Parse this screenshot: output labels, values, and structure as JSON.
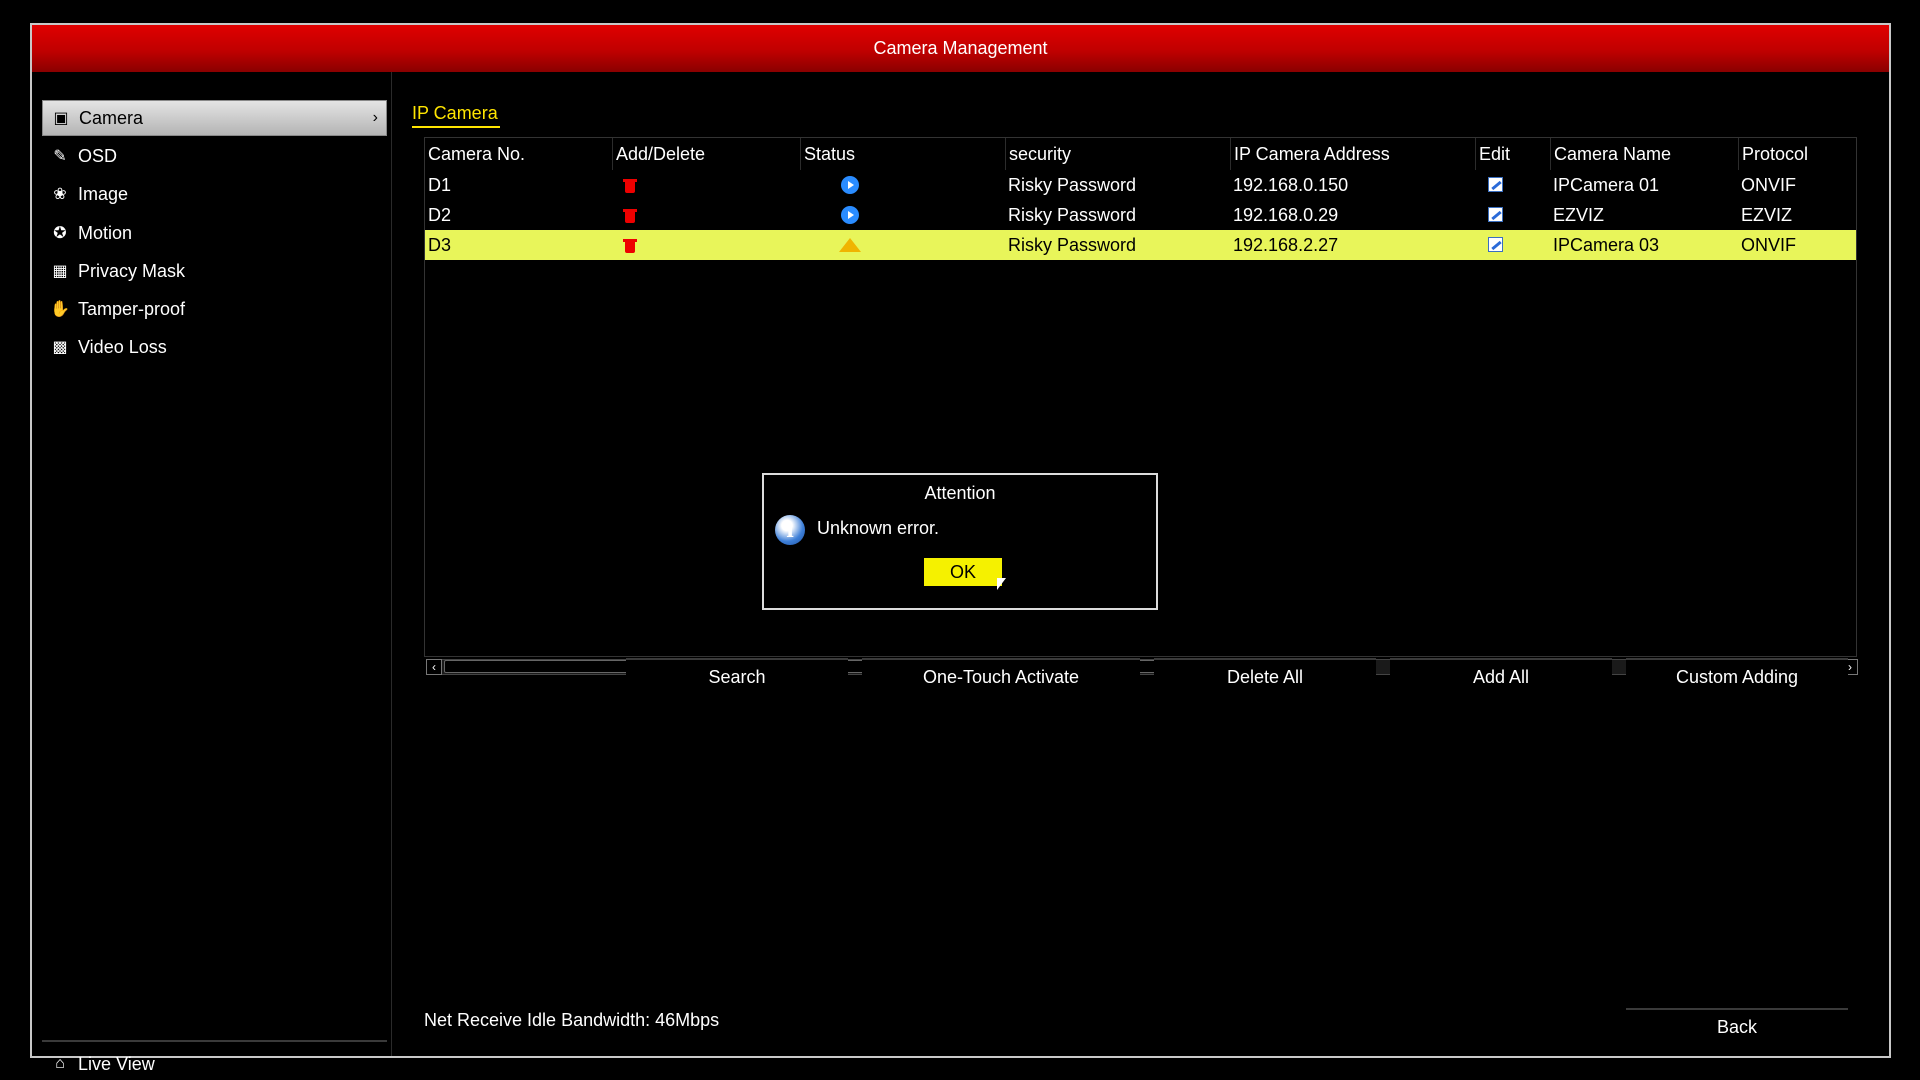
{
  "window": {
    "title": "Camera Management"
  },
  "sidebar": {
    "items": [
      {
        "label": "Camera",
        "icon": "camera-icon",
        "active": true
      },
      {
        "label": "OSD",
        "icon": "osd-icon"
      },
      {
        "label": "Image",
        "icon": "image-icon"
      },
      {
        "label": "Motion",
        "icon": "motion-icon"
      },
      {
        "label": "Privacy Mask",
        "icon": "privacy-mask-icon"
      },
      {
        "label": "Tamper-proof",
        "icon": "tamper-proof-icon"
      },
      {
        "label": "Video Loss",
        "icon": "video-loss-icon"
      }
    ],
    "live_view": "Live View"
  },
  "tab": {
    "label": "IP Camera"
  },
  "table": {
    "headers": [
      "Camera No.",
      "Add/Delete",
      "Status",
      "security",
      "IP Camera Address",
      "Edit",
      "Camera Name",
      "Protocol"
    ],
    "rows": [
      {
        "camera_no": "D1",
        "status": "playing",
        "security": "Risky Password",
        "ip": "192.168.0.150",
        "name": "IPCamera 01",
        "protocol": "ONVIF"
      },
      {
        "camera_no": "D2",
        "status": "playing",
        "security": "Risky Password",
        "ip": "192.168.0.29",
        "name": "EZVIZ",
        "protocol": "EZVIZ"
      },
      {
        "camera_no": "D3",
        "status": "warning",
        "security": "Risky Password",
        "ip": "192.168.2.27",
        "name": "IPCamera 03",
        "protocol": "ONVIF",
        "selected": true
      }
    ]
  },
  "buttons": {
    "search": "Search",
    "one_touch": "One-Touch Activate",
    "delete_all": "Delete All",
    "add_all": "Add All",
    "custom_adding": "Custom Adding",
    "back": "Back"
  },
  "status": {
    "bandwidth": "Net Receive Idle Bandwidth: 46Mbps"
  },
  "dialog": {
    "title": "Attention",
    "message": "Unknown error.",
    "ok": "OK"
  },
  "colors": {
    "titlebar": "#d00000",
    "accent": "#ffe500",
    "selected_row": "#e8f55a"
  }
}
